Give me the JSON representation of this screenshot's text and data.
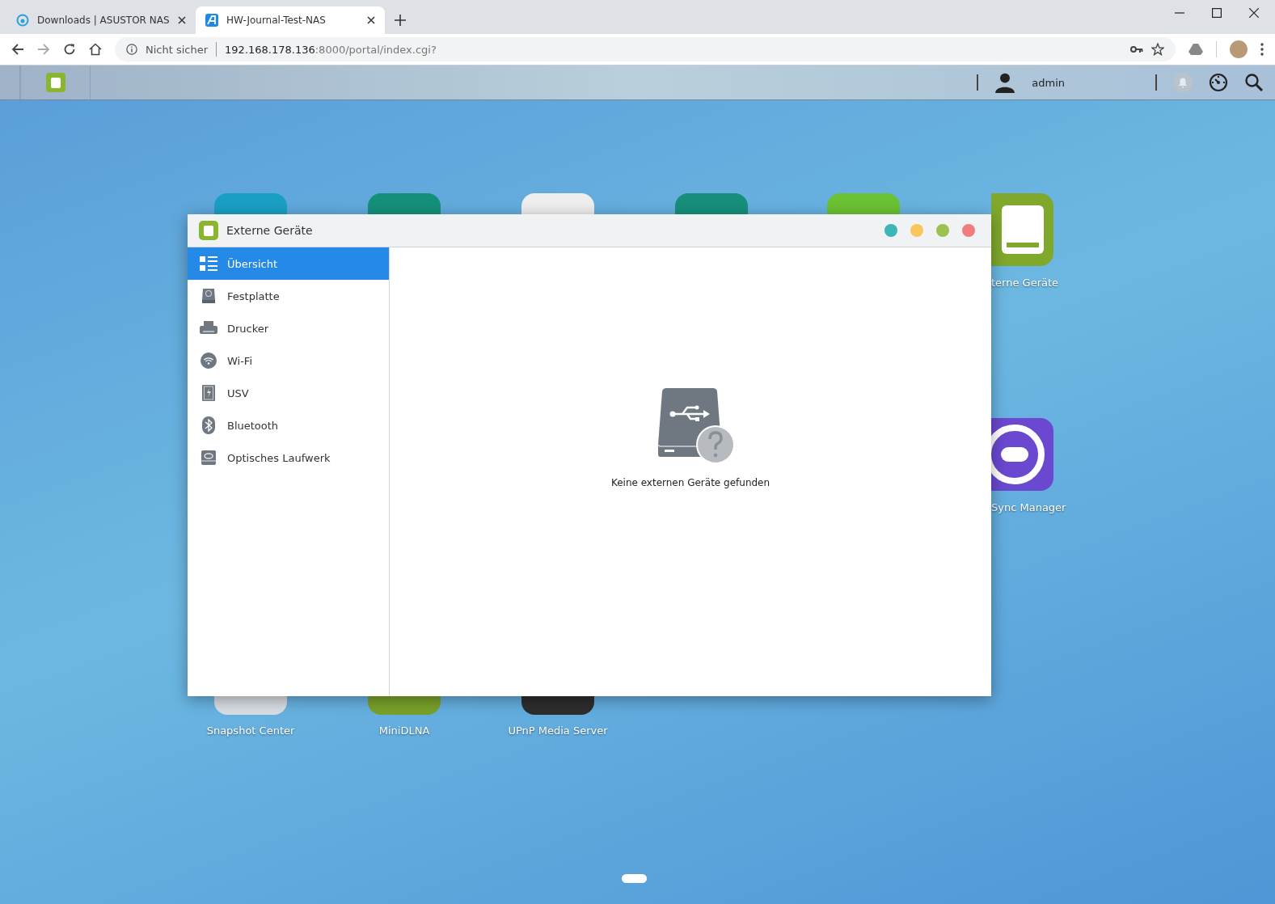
{
  "browser": {
    "tabs": [
      {
        "title": "Downloads | ASUSTOR NAS",
        "selected": false
      },
      {
        "title": "HW-Journal-Test-NAS",
        "selected": true
      }
    ],
    "address": {
      "security": "Nicht sicher",
      "host": "192.168.178.136",
      "path": ":8000/portal/index.cgi?"
    }
  },
  "nas_bar": {
    "user": "admin"
  },
  "desktop_icons": [
    {
      "color": "#1a9fc4"
    },
    {
      "color": "#14907a"
    },
    {
      "color": "#eeeeee"
    },
    {
      "color": "#178f7c"
    },
    {
      "color": "#6cc233"
    },
    {
      "label": "terne Geräte",
      "color": "#7fa82c"
    },
    {
      "label": "Sync Manager",
      "color": "#6a48d0"
    },
    {
      "label": "Snapshot Center",
      "color": "#d8dde3"
    },
    {
      "label": "MiniDLNA",
      "color": "#79a02a"
    },
    {
      "label": "UPnP Media Server",
      "color": "#2d2d2d"
    }
  ],
  "window": {
    "title": "Externe Geräte",
    "controls": [
      {
        "color": "#3cb5b9"
      },
      {
        "color": "#f9c65c"
      },
      {
        "color": "#9dc14e"
      },
      {
        "color": "#f27b7e"
      }
    ],
    "sidebar": [
      {
        "label": "Übersicht",
        "kind": "overview",
        "selected": true
      },
      {
        "label": "Festplatte",
        "kind": "disk",
        "selected": false
      },
      {
        "label": "Drucker",
        "kind": "printer",
        "selected": false
      },
      {
        "label": "Wi-Fi",
        "kind": "wifi",
        "selected": false
      },
      {
        "label": "USV",
        "kind": "ups",
        "selected": false
      },
      {
        "label": "Bluetooth",
        "kind": "bluetooth",
        "selected": false
      },
      {
        "label": "Optisches Laufwerk",
        "kind": "optical",
        "selected": false
      }
    ],
    "empty_message": "Keine externen Geräte gefunden"
  }
}
